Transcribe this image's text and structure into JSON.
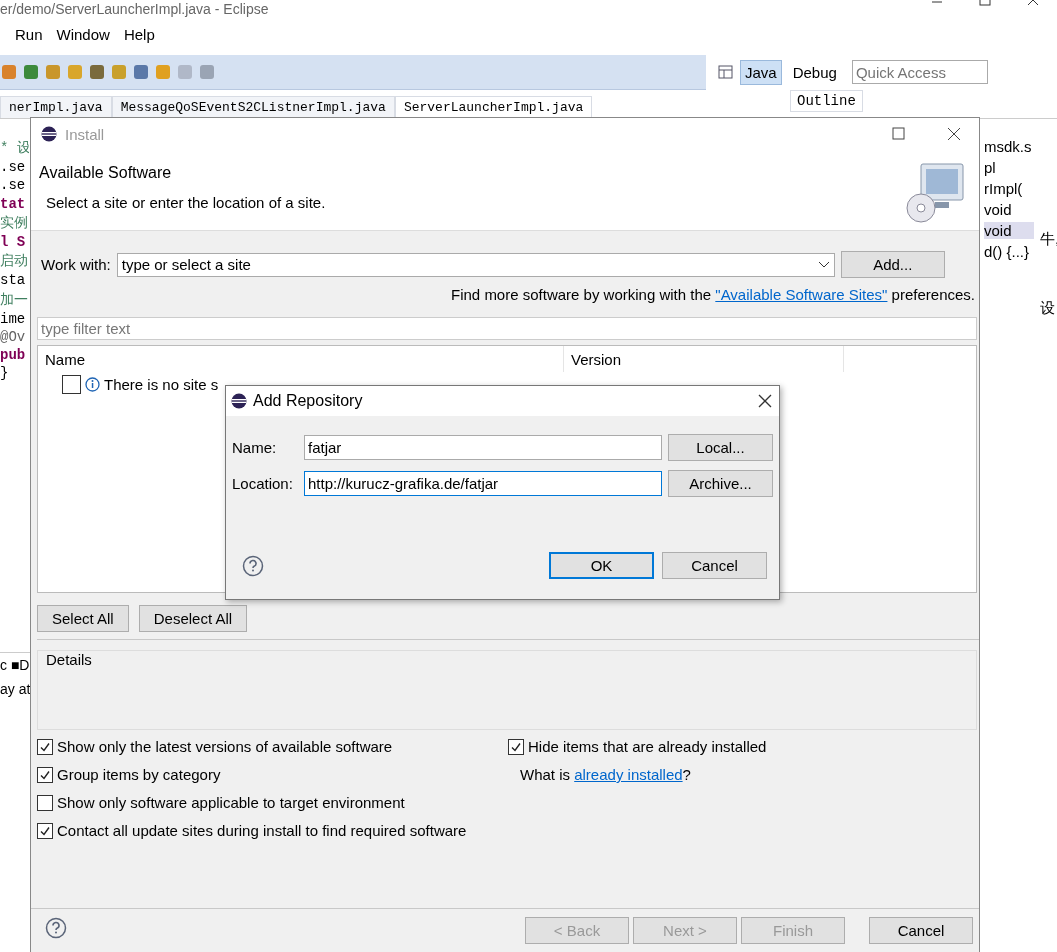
{
  "window": {
    "title": "er/demo/ServerLauncherImpl.java - Eclipse"
  },
  "menu": [
    {
      "label": "Run"
    },
    {
      "label": "Window"
    },
    {
      "label": "Help"
    }
  ],
  "perspectives": [
    {
      "label": "Java",
      "selected": true
    },
    {
      "label": "Debug",
      "selected": false
    }
  ],
  "quick_access": {
    "placeholder": "Quick Access"
  },
  "editor_tabs": [
    {
      "label": "nerImpl.java",
      "selected": false
    },
    {
      "label": "MessageQoSEventS2CListnerImpl.java",
      "selected": false
    },
    {
      "label": "ServerLauncherImpl.java",
      "selected": true
    }
  ],
  "outline_tab": {
    "label": "Outline"
  },
  "code_fragments": [
    {
      "text": "* 设",
      "kind": "comment"
    },
    {
      "text": ".se",
      "kind": "plain"
    },
    {
      "text": ".se",
      "kind": "plain"
    },
    {
      "text": "tat",
      "kind": "keyword"
    },
    {
      "text": "实例",
      "kind": "comment"
    },
    {
      "text": "l S",
      "kind": "keyword"
    },
    {
      "text": "启动",
      "kind": "comment"
    },
    {
      "text": "sta",
      "kind": "plain"
    },
    {
      "text": "加一",
      "kind": "comment"
    },
    {
      "text": "ime",
      "kind": "plain"
    },
    {
      "text": "@Ov",
      "kind": "annotation"
    },
    {
      "text": "pub",
      "kind": "keyword"
    },
    {
      "text": "}",
      "kind": "plain"
    }
  ],
  "outline_fragments": [
    {
      "text": "msdk.s",
      "selected": false
    },
    {
      "text": "pl",
      "selected": false
    },
    {
      "text": "rImpl(",
      "selected": false
    },
    {
      "text": "void",
      "selected": false
    },
    {
      "text": "void",
      "selected": true
    },
    {
      "text": "d() {...}",
      "selected": false
    }
  ],
  "edge_fragments": [
    "牛,",
    "设"
  ],
  "console_fragments": [
    "c ■D",
    "ay at"
  ],
  "install_dialog": {
    "title": "Install",
    "heading": "Available Software",
    "description": "Select a site or enter the location of a site.",
    "work_with": {
      "label": "Work with:",
      "placeholder": "type or select a site",
      "button": "Add..."
    },
    "find_more": {
      "before": "Find more software by working with the ",
      "link": "\"Available Software Sites\"",
      "after": " preferences."
    },
    "filter": {
      "placeholder": "type filter text"
    },
    "table": {
      "columns": [
        "Name",
        "Version"
      ],
      "rows": [
        {
          "label": "There is no site s",
          "checked": false
        }
      ]
    },
    "buttons": [
      "Select All",
      "Deselect All"
    ],
    "details": {
      "label": "Details"
    },
    "options_left": [
      {
        "label": "Show only the latest versions of available software",
        "checked": true
      },
      {
        "label": "Group items by category",
        "checked": true
      },
      {
        "label": "Show only software applicable to target environment",
        "checked": false
      },
      {
        "label": "Contact all update sites during install to find required software",
        "checked": true
      }
    ],
    "options_right": [
      {
        "label": "Hide items that are already installed",
        "checked": true
      }
    ],
    "installed_hint": {
      "before": "What is ",
      "link": "already installed",
      "after": "?"
    },
    "footer_buttons": [
      {
        "label": "< Back",
        "disabled": true
      },
      {
        "label": "Next >",
        "disabled": true
      },
      {
        "label": "Finish",
        "disabled": true
      },
      {
        "label": "Cancel",
        "disabled": false
      }
    ]
  },
  "add_repository": {
    "title": "Add Repository",
    "fields": [
      {
        "label": "Name:",
        "value": "fatjar",
        "focused": false,
        "button": "Local..."
      },
      {
        "label": "Location:",
        "value": "http://kurucz-grafika.de/fatjar",
        "focused": true,
        "button": "Archive..."
      }
    ],
    "buttons": [
      {
        "label": "OK",
        "default": true
      },
      {
        "label": "Cancel",
        "default": false
      }
    ]
  }
}
